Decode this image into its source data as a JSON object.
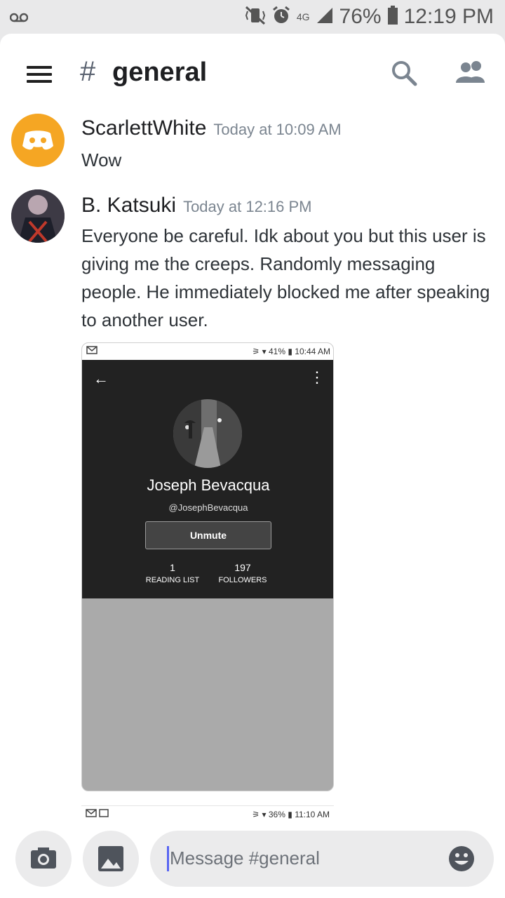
{
  "status_bar": {
    "voicemail_icon": "voicemail-icon",
    "network": "4G",
    "battery": "76%",
    "time": "12:19 PM"
  },
  "header": {
    "hash": "#",
    "channel": "general"
  },
  "messages": [
    {
      "author": "ScarlettWhite",
      "timestamp": "Today at 10:09 AM",
      "text": "Wow",
      "avatar_color": "#f5a623"
    },
    {
      "author": "B. Katsuki",
      "timestamp": "Today at 12:16 PM",
      "text": "Everyone be careful. Idk about you but this user is giving me the creeps. Randomly messaging people. He immediately blocked me after speaking to another user."
    }
  ],
  "attachment1": {
    "status_battery": "41%",
    "status_time": "10:44 AM",
    "profile_name": "Joseph Bevacqua",
    "profile_handle": "@JosephBevacqua",
    "button_label": "Unmute",
    "stats": [
      {
        "value": "1",
        "label": "READING LIST"
      },
      {
        "value": "197",
        "label": "FOLLOWERS"
      }
    ]
  },
  "attachment2": {
    "status_battery": "36%",
    "status_time": "11:10 AM"
  },
  "composer": {
    "placeholder": "Message #general"
  },
  "colors": {
    "discord_orange": "#f5a623",
    "accent": "#5865f2"
  }
}
